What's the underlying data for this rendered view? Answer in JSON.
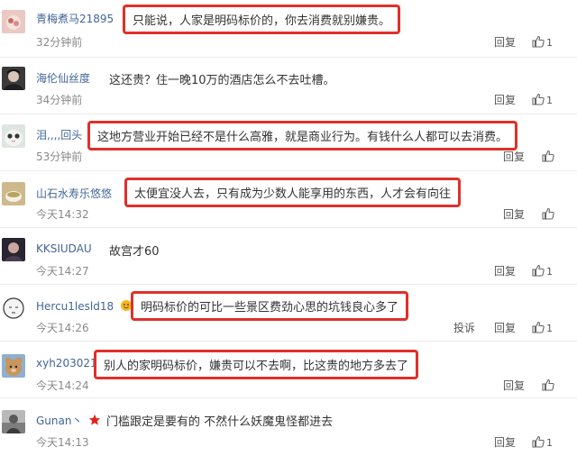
{
  "icons": {
    "reply": "reply-text",
    "like": "thumbs-up-icon",
    "vip_badge": "emoji-badge-icon",
    "star_badge": "red-star-icon"
  },
  "colors": {
    "username": "#406599",
    "highlight_box": "#e0302a",
    "timestamp": "#8a8a8a"
  },
  "comments": [
    {
      "username": "青梅煮马21895",
      "text": "只能说，人家是明码标价的，你去消费就别嫌贵。",
      "time": "32分钟前",
      "reply": "回复",
      "likes": "1",
      "highlighted": true
    },
    {
      "username": "海伦仙丝度",
      "text": "这还贵？住一晚10万的酒店怎么不去吐槽。",
      "time": "34分钟前",
      "reply": "回复",
      "likes": "1",
      "highlighted": false
    },
    {
      "username": "泪,,,,回头",
      "text": "这地方营业开始已经不是什么高雅，就是商业行为。有钱什么人都可以去消费。",
      "time": "53分钟前",
      "reply": "回复",
      "likes": "",
      "highlighted": true
    },
    {
      "username": "山石水寿乐悠悠",
      "text": "太便宜没人去，只有成为少数人能享用的东西，人才会有向往",
      "time": "今天14:32",
      "reply": "回复",
      "likes": "",
      "highlighted": true
    },
    {
      "username": "KKSIUDAU",
      "text": "故宫才60",
      "time": "今天14:27",
      "reply": "回复",
      "likes": "1",
      "highlighted": false
    },
    {
      "username": "Hercu1lesld18",
      "text": "明码标价的可比一些景区费劲心思的坑钱良心多了",
      "time": "今天14:26",
      "report": "投诉",
      "reply": "回复",
      "likes": "1",
      "highlighted": true
    },
    {
      "username": "xyh203021",
      "text": "别人的家明码标价，嫌贵可以不去啊，比这贵的地方多去了",
      "time": "今天14:24",
      "reply": "回复",
      "likes": "",
      "highlighted": true
    },
    {
      "username": "Gunan丶",
      "text": "门槛跟定是要有的 不然什么妖魔鬼怪都进去",
      "time": "今天14:13",
      "reply": "回复",
      "likes": "1",
      "highlighted": false
    }
  ]
}
